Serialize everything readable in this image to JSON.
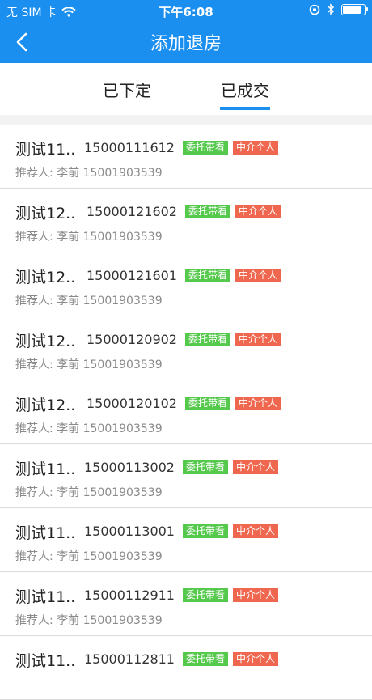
{
  "status_bar": {
    "carrier": "无 SIM 卡",
    "time": "下午6:08"
  },
  "nav": {
    "title": "添加退房"
  },
  "tabs": [
    {
      "label": "已下定"
    },
    {
      "label": "已成交"
    }
  ],
  "items": [
    {
      "name": "测试11..",
      "phone": "15000111612",
      "tag1": "委托带看",
      "tag2": "中介个人",
      "referrer": "推荐人:  李前 15001903539"
    },
    {
      "name": "测试12..",
      "phone": "15000121602",
      "tag1": "委托带看",
      "tag2": "中介个人",
      "referrer": "推荐人:  李前 15001903539"
    },
    {
      "name": "测试12..",
      "phone": "15000121601",
      "tag1": "委托带看",
      "tag2": "中介个人",
      "referrer": "推荐人:  李前 15001903539"
    },
    {
      "name": "测试12..",
      "phone": "15000120902",
      "tag1": "委托带看",
      "tag2": "中介个人",
      "referrer": "推荐人:  李前 15001903539"
    },
    {
      "name": "测试12..",
      "phone": "15000120102",
      "tag1": "委托带看",
      "tag2": "中介个人",
      "referrer": "推荐人:  李前 15001903539"
    },
    {
      "name": "测试11..",
      "phone": "15000113002",
      "tag1": "委托带看",
      "tag2": "中介个人",
      "referrer": "推荐人:  李前 15001903539"
    },
    {
      "name": "测试11..",
      "phone": "15000113001",
      "tag1": "委托带看",
      "tag2": "中介个人",
      "referrer": "推荐人:  李前 15001903539"
    },
    {
      "name": "测试11..",
      "phone": "15000112911",
      "tag1": "委托带看",
      "tag2": "中介个人",
      "referrer": "推荐人:  李前 15001903539"
    },
    {
      "name": "测试11..",
      "phone": "15000112811",
      "tag1": "委托带看",
      "tag2": "中介个人",
      "referrer": ""
    }
  ]
}
